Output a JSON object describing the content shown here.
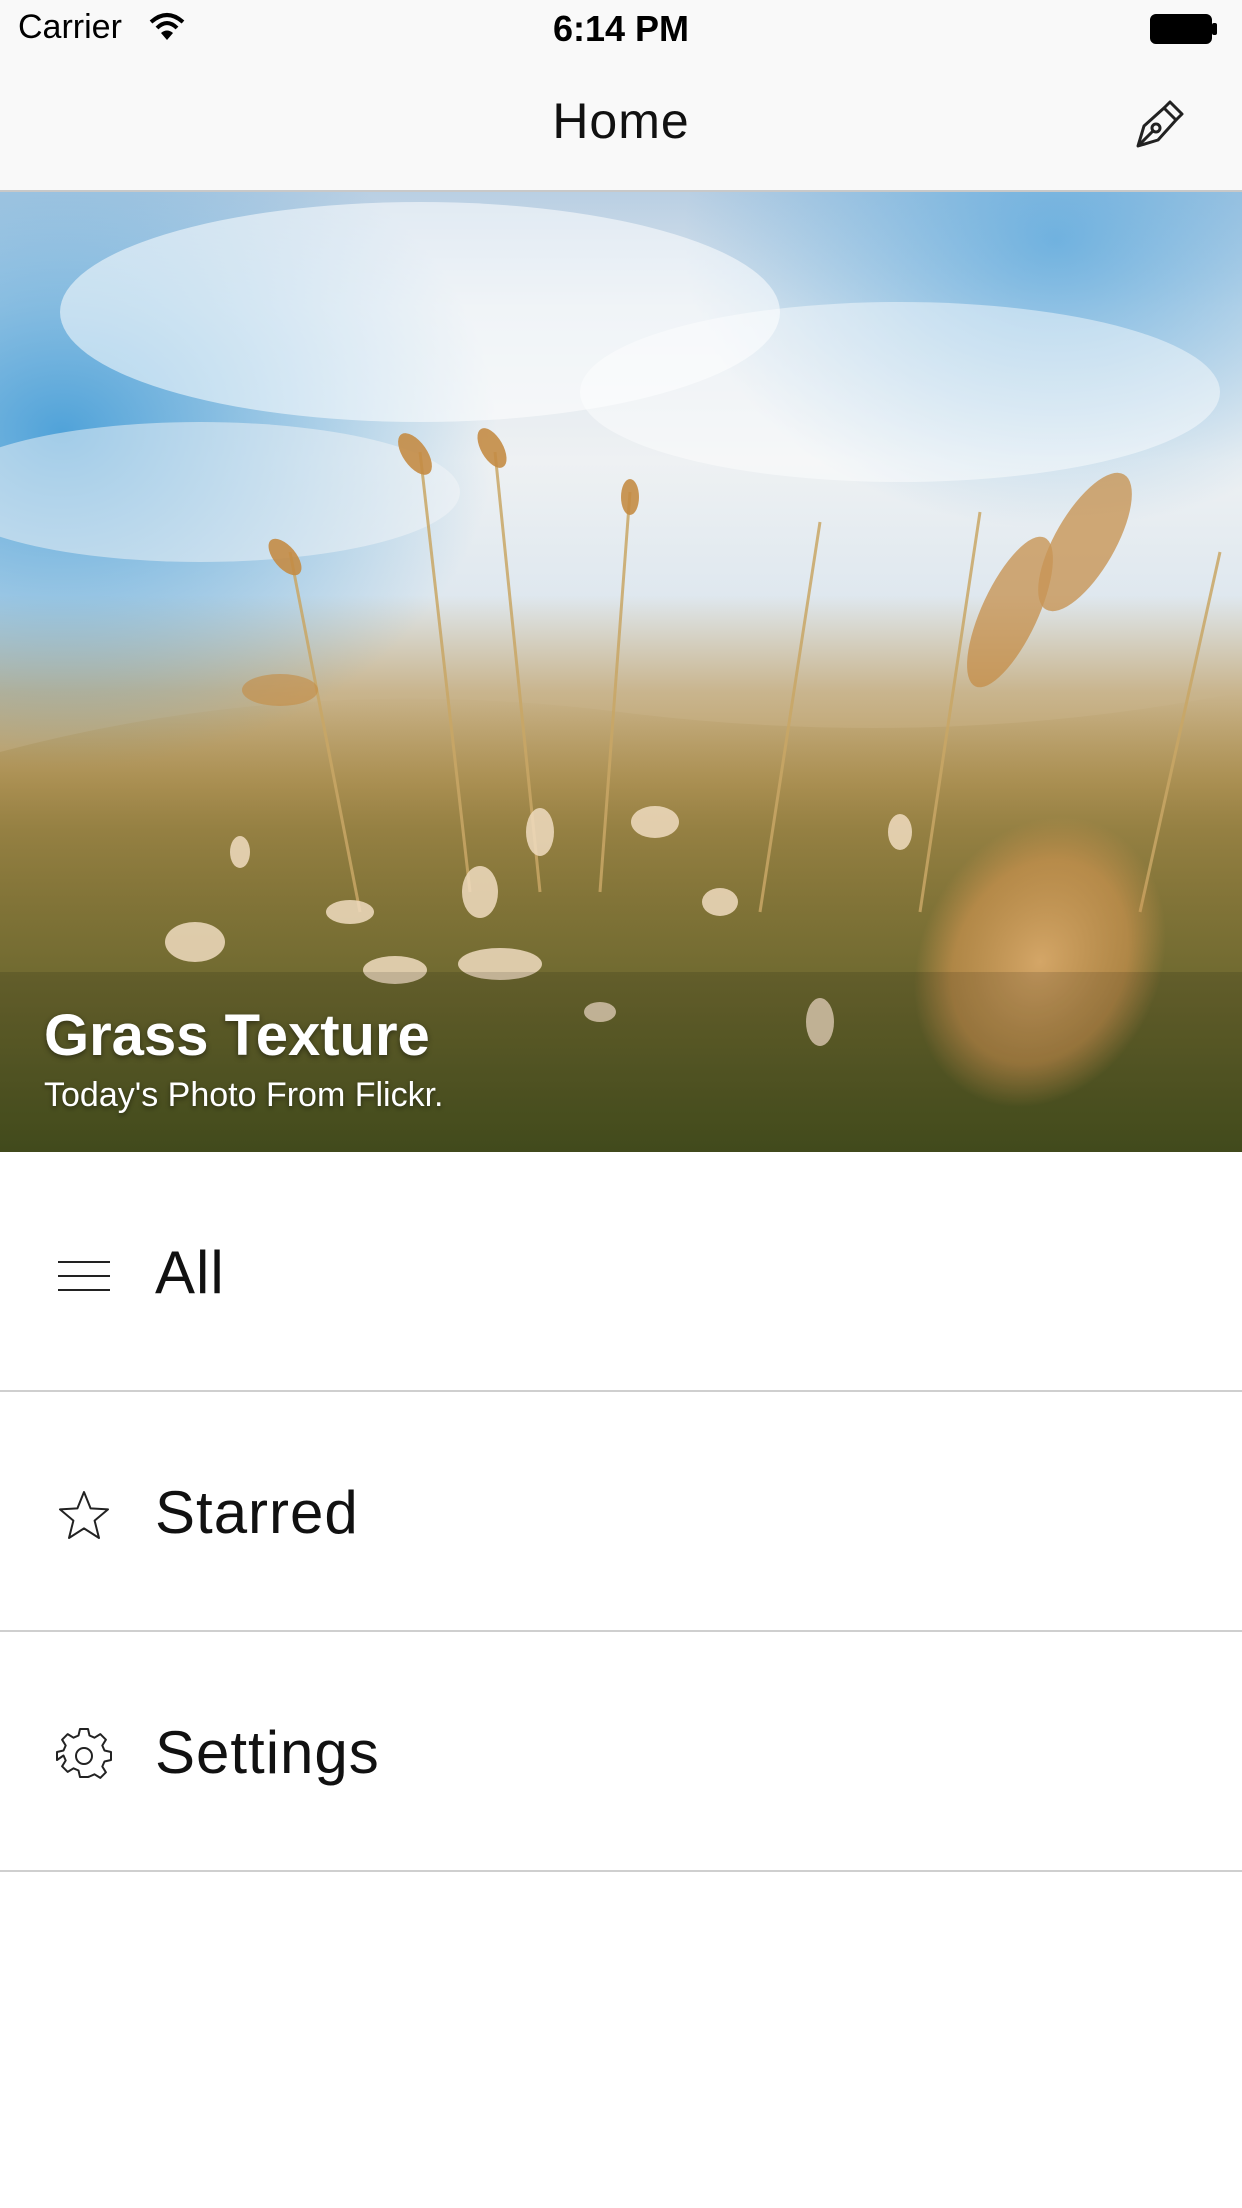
{
  "status_bar": {
    "carrier": "Carrier",
    "time": "6:14 PM",
    "icons": [
      "wifi-icon",
      "battery-icon"
    ]
  },
  "nav_bar": {
    "title": "Home",
    "right_icon": "compose-pen-icon"
  },
  "hero": {
    "title": "Grass Texture",
    "subtitle": "Today's Photo From Flickr."
  },
  "menu": {
    "items": [
      {
        "label": "All",
        "icon": "hamburger-icon"
      },
      {
        "label": "Starred",
        "icon": "star-icon"
      },
      {
        "label": "Settings",
        "icon": "gear-icon"
      }
    ]
  },
  "colors": {
    "background": "#ffffff",
    "bar_background": "#f9f9f9",
    "separator": "#cfcfcf",
    "text": "#111111"
  }
}
